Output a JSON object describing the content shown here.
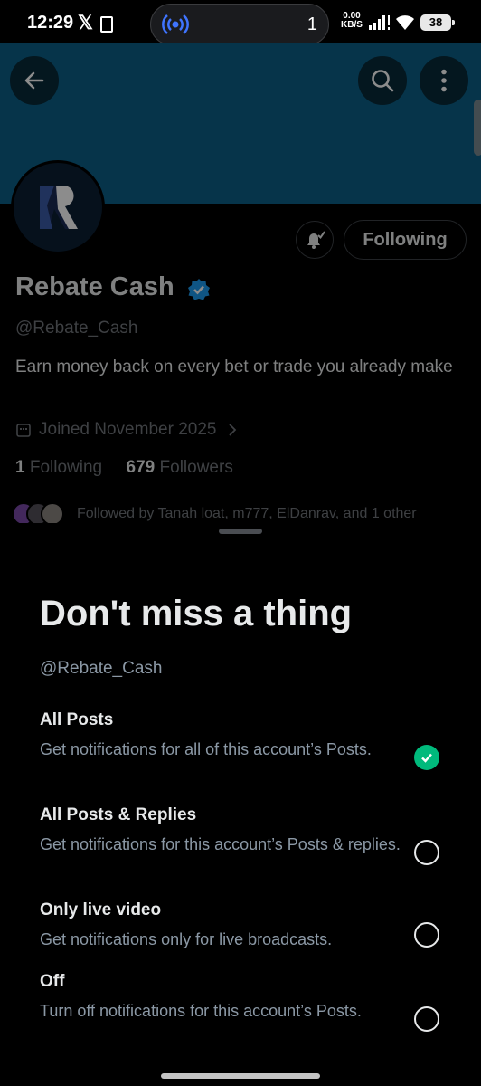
{
  "status_bar": {
    "time": "12:29",
    "x_logo": "𝕏",
    "island_count": "1",
    "net_speed_value": "0.00",
    "net_speed_unit": "KB/S",
    "battery": "38"
  },
  "profile": {
    "name": "Rebate Cash",
    "handle": "@Rebate_Cash",
    "bio": "Earn money back on every bet or trade you already make",
    "joined": "Joined November 2025",
    "following_count": "1",
    "following_label": "Following",
    "followers_count": "679",
    "followers_label": "Followers",
    "followed_by": "Followed by Tanah loat, m777, ElDanrav, and 1 other",
    "following_button_label": "Following"
  },
  "sheet": {
    "title": "Don't miss a thing",
    "handle": "@Rebate_Cash",
    "options": [
      {
        "title": "All Posts",
        "description": "Get notifications for all of this account’s Posts.",
        "selected": true
      },
      {
        "title": "All Posts & Replies",
        "description": "Get notifications for this account’s Posts & replies.",
        "selected": false
      },
      {
        "title": "Only live video",
        "description": "Get notifications only for live broadcasts.",
        "selected": false
      },
      {
        "title": "Off",
        "description": "Turn off notifications for this account’s Posts.",
        "selected": false
      }
    ]
  },
  "colors": {
    "banner": "#0b5f87",
    "accent_check": "#00ba7c",
    "verified": "#1d9bf0",
    "background": "#000000"
  }
}
